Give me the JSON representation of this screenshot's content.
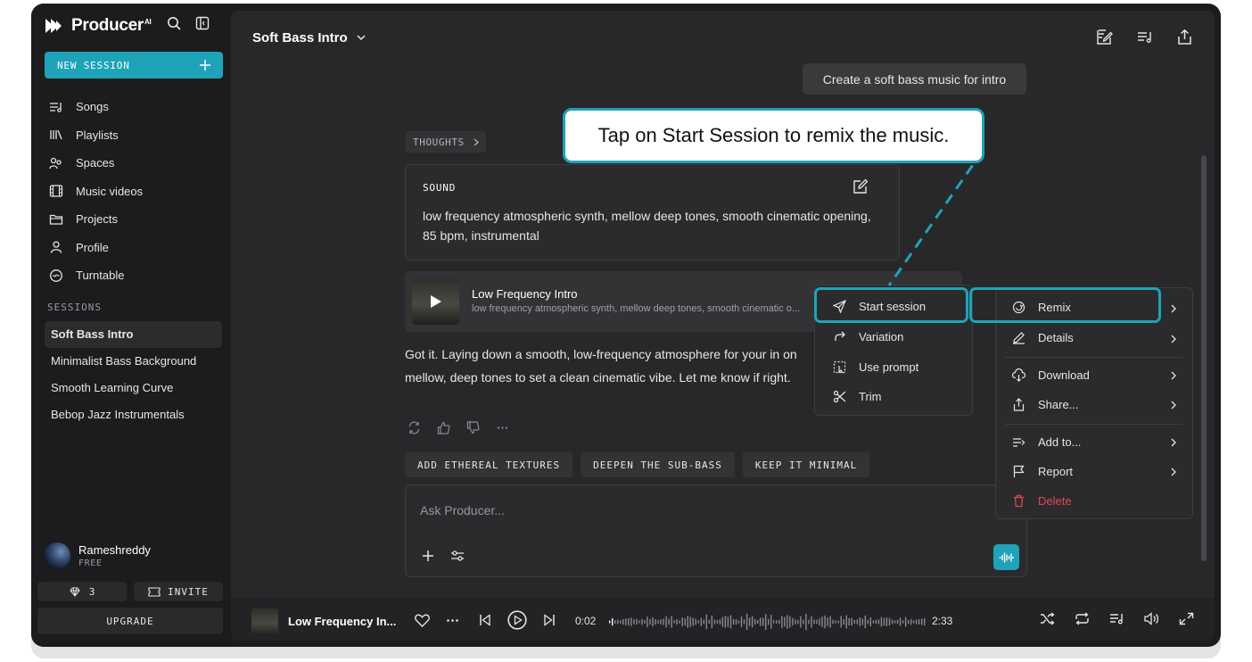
{
  "app": {
    "name": "Producer",
    "name_sup": "AI"
  },
  "sidebar": {
    "new_session_label": "NEW SESSION",
    "nav": [
      {
        "label": "Songs",
        "icon": "songs-icon"
      },
      {
        "label": "Playlists",
        "icon": "playlists-icon"
      },
      {
        "label": "Spaces",
        "icon": "spaces-icon"
      },
      {
        "label": "Music videos",
        "icon": "music-videos-icon"
      },
      {
        "label": "Projects",
        "icon": "folder-icon"
      },
      {
        "label": "Profile",
        "icon": "user-icon"
      },
      {
        "label": "Turntable",
        "icon": "turntable-icon"
      }
    ],
    "sessions_label": "SESSIONS",
    "sessions": [
      {
        "label": "Soft Bass Intro",
        "active": true
      },
      {
        "label": "Minimalist Bass Background",
        "active": false
      },
      {
        "label": "Smooth Learning Curve",
        "active": false
      },
      {
        "label": "Bebop Jazz Instrumentals",
        "active": false
      }
    ],
    "user": {
      "name": "Rameshreddy",
      "plan": "FREE"
    },
    "gems": "3",
    "invite_label": "INVITE",
    "upgrade_label": "UPGRADE"
  },
  "header": {
    "title": "Soft Bass Intro"
  },
  "chat": {
    "user_prompt": "Create a soft bass music for intro",
    "thoughts_label": "THOUGHTS",
    "sound_label": "SOUND",
    "sound_text": "low frequency atmospheric synth, mellow deep tones, smooth cinematic opening, 85 bpm, instrumental",
    "track_title": "Low Frequency Intro",
    "track_desc": "low frequency atmospheric synth, mellow deep tones, smooth cinematic o...",
    "reply": "Got it. Laying down a smooth, low-frequency atmosphere for your in on mellow, deep tones to set a clean cinematic vibe. Let me know if right.",
    "suggestions": [
      "ADD ETHEREAL TEXTURES",
      "DEEPEN THE SUB-BASS",
      "KEEP IT MINIMAL"
    ],
    "composer_placeholder": "Ask Producer..."
  },
  "menu_primary": [
    "Start session",
    "Variation",
    "Use prompt",
    "Trim"
  ],
  "menu_secondary": [
    {
      "label": "Remix",
      "submenu": true
    },
    {
      "label": "Details",
      "submenu": true
    },
    {
      "label": "Download",
      "submenu": true
    },
    {
      "label": "Share...",
      "submenu": true
    },
    {
      "label": "Add to...",
      "submenu": true
    },
    {
      "label": "Report",
      "submenu": true
    },
    {
      "label": "Delete",
      "submenu": false
    }
  ],
  "callout": {
    "text": "Tap on Start Session to remix the music."
  },
  "player": {
    "title": "Low Frequency In...",
    "current_time": "0:02",
    "duration": "2:33",
    "progress": 0.013
  },
  "colors": {
    "accent": "#1fa3b8",
    "danger": "#e0484d",
    "background": "#1c1c1e",
    "panel": "#28282b"
  }
}
